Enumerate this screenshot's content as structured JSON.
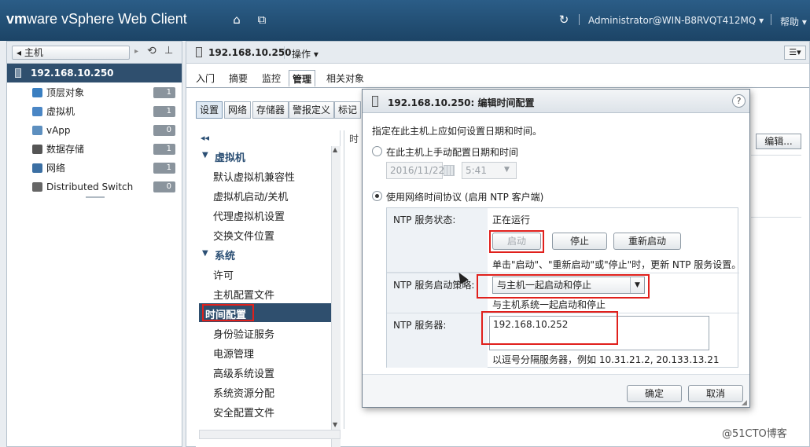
{
  "app": {
    "brand_vm": "vm",
    "brand_ware": "ware",
    "brand_rest": "vSphere Web Client"
  },
  "topbar": {
    "user": "Administrator@WIN-B8RVQT412MQ ▾",
    "help": "帮助 ▾"
  },
  "navigator": {
    "back_label": "主机",
    "host": "192.168.10.250",
    "items": [
      {
        "label": "顶层对象",
        "count": "1",
        "icon": "globe-icon",
        "color": "#3a7fc1"
      },
      {
        "label": "虚拟机",
        "count": "1",
        "icon": "vm-icon",
        "color": "#4a86c5"
      },
      {
        "label": "vApp",
        "count": "0",
        "icon": "vapp-icon",
        "color": "#5d8fbf"
      },
      {
        "label": "数据存储",
        "count": "1",
        "icon": "datastore-icon",
        "color": "#555"
      },
      {
        "label": "网络",
        "count": "1",
        "icon": "network-icon",
        "color": "#3b6fa3"
      },
      {
        "label": "Distributed Switch",
        "count": "0",
        "icon": "switch-icon",
        "color": "#666"
      }
    ]
  },
  "main": {
    "host_title": "192.168.10.250",
    "actions": "操作 ▾",
    "tabs": [
      "入门",
      "摘要",
      "监控",
      "管理",
      "相关对象"
    ],
    "active_tab": "管理",
    "subtabs": [
      "设置",
      "网络",
      "存储器",
      "警报定义",
      "标记"
    ],
    "active_subtab": "设置",
    "tree": {
      "group_vm": "虚拟机",
      "vm_items": [
        "默认虚拟机兼容性",
        "虚拟机启动/关机",
        "代理虚拟机设置",
        "交换文件位置"
      ],
      "group_system": "系统",
      "system_items": [
        "许可",
        "主机配置文件",
        "时间配置",
        "身份验证服务",
        "电源管理",
        "高级系统设置",
        "系统资源分配",
        "安全配置文件"
      ],
      "selected": "时间配置"
    },
    "right_pane_label": "时",
    "edit_button": "编辑..."
  },
  "dialog": {
    "title": "192.168.10.250: 编辑时间配置",
    "help": "?",
    "intro": "指定在此主机上应如何设置日期和时间。",
    "manual_option": "在此主机上手动配置日期和时间",
    "manual_date": "2016/11/22",
    "manual_time": "5:41",
    "ntp_option": "使用网络时间协议 (启用 NTP 客户端)",
    "service_status_label": "NTP 服务状态:",
    "service_status": "正在运行",
    "start": "启动",
    "stop": "停止",
    "restart": "重新启动",
    "service_hint": "单击\"启动\"、\"重新启动\"或\"停止\"时，更新 NTP 服务设置。",
    "policy_label": "NTP 服务启动策略:",
    "policy_value": "与主机一起启动和停止",
    "policy_hint": "与主机系统一起启动和停止",
    "servers_label": "NTP 服务器:",
    "servers_value": "192.168.10.252",
    "servers_hint": "以逗号分隔服务器，例如 10.31.21.2, 20.133.13.21",
    "ok": "确定",
    "cancel": "取消"
  },
  "watermark": "@51CTO博客",
  "colors": {
    "highlight": "#e0201c",
    "selection": "#2f4f6e"
  }
}
